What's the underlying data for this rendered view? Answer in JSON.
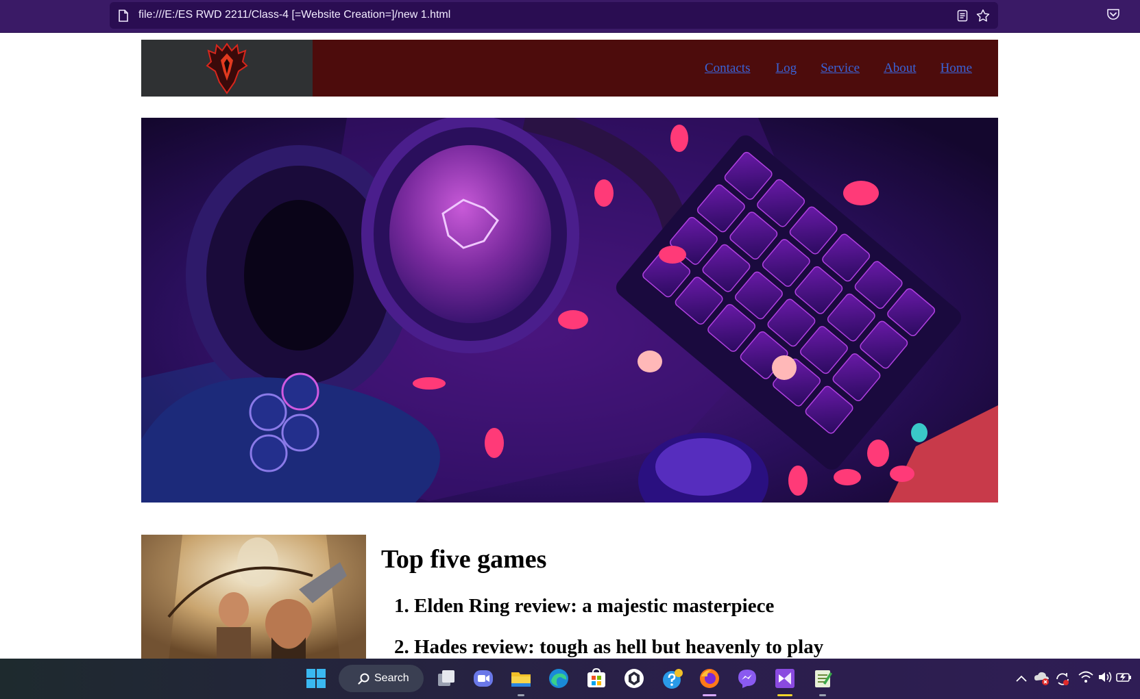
{
  "browser": {
    "url": "file:///E:/ES RWD 2211/Class-4 [=Website Creation=]/new 1.html"
  },
  "header": {
    "nav": [
      "Contacts",
      "Log",
      "Service",
      "About",
      "Home"
    ]
  },
  "content": {
    "title": "Top five games",
    "games": [
      "1. Elden Ring review: a majestic masterpiece",
      "2. Hades review: tough as hell but heavenly to play"
    ]
  },
  "taskbar": {
    "search_label": "Search",
    "apps": [
      "start-icon",
      "task-view-icon",
      "zoom-icon",
      "file-explorer-icon",
      "edge-icon",
      "store-icon",
      "github-icon",
      "help-icon",
      "firefox-icon",
      "messenger-icon",
      "visual-studio-icon",
      "notepad-icon"
    ]
  },
  "colors": {
    "browser_bar": "#3a1a66",
    "header_bg": "#4d0c0c",
    "logo_bg": "#2f3133",
    "link": "#3a63d8"
  }
}
